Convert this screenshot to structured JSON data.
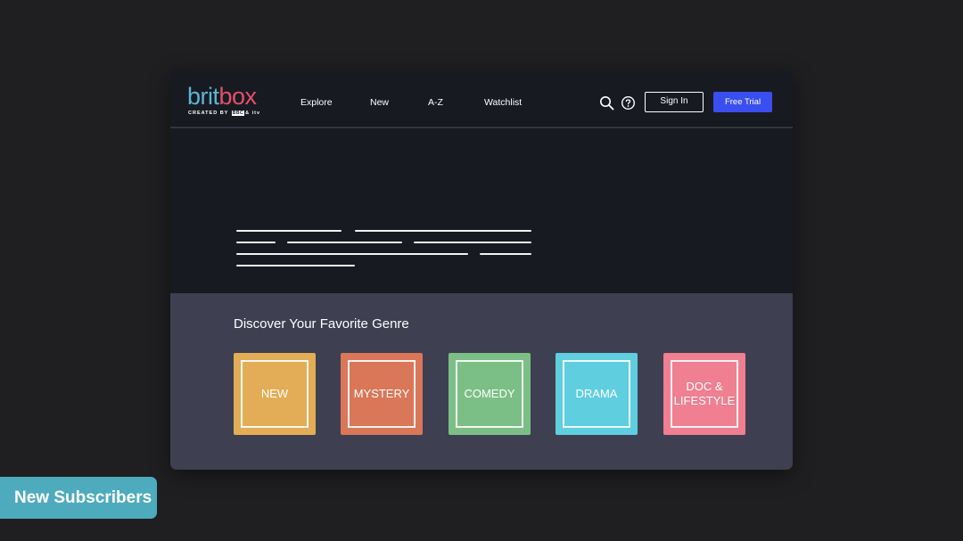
{
  "brand": {
    "word_part1": "brit",
    "word_part2": "box",
    "tagline": "CREATED BY",
    "partner1": "BBC",
    "partner_joiner": "&",
    "partner2": "itv",
    "colors": {
      "brit": "#5bb5d6",
      "box": "#e3506a"
    }
  },
  "nav": {
    "items": [
      {
        "label": "Explore"
      },
      {
        "label": "New"
      },
      {
        "label": "A-Z"
      },
      {
        "label": "Watchlist"
      }
    ]
  },
  "header": {
    "search_icon": "search-icon",
    "help_icon": "help-icon",
    "sign_in_label": "Sign In",
    "free_trial_label": "Free Trial",
    "accent": "#3b4ff0"
  },
  "genres": {
    "title": "Discover Your Favorite Genre",
    "tiles": [
      {
        "label": "NEW",
        "color": "#e2ad56"
      },
      {
        "label": "MYSTERY",
        "color": "#d97758"
      },
      {
        "label": "COMEDY",
        "color": "#7cbf86"
      },
      {
        "label": "DRAMA",
        "color": "#5fcfe0"
      },
      {
        "label": "DOC &\nLIFESTYLE",
        "color": "#ef7f91"
      }
    ]
  },
  "badge": {
    "label": "New Subscribers",
    "color": "#4eabbd"
  }
}
